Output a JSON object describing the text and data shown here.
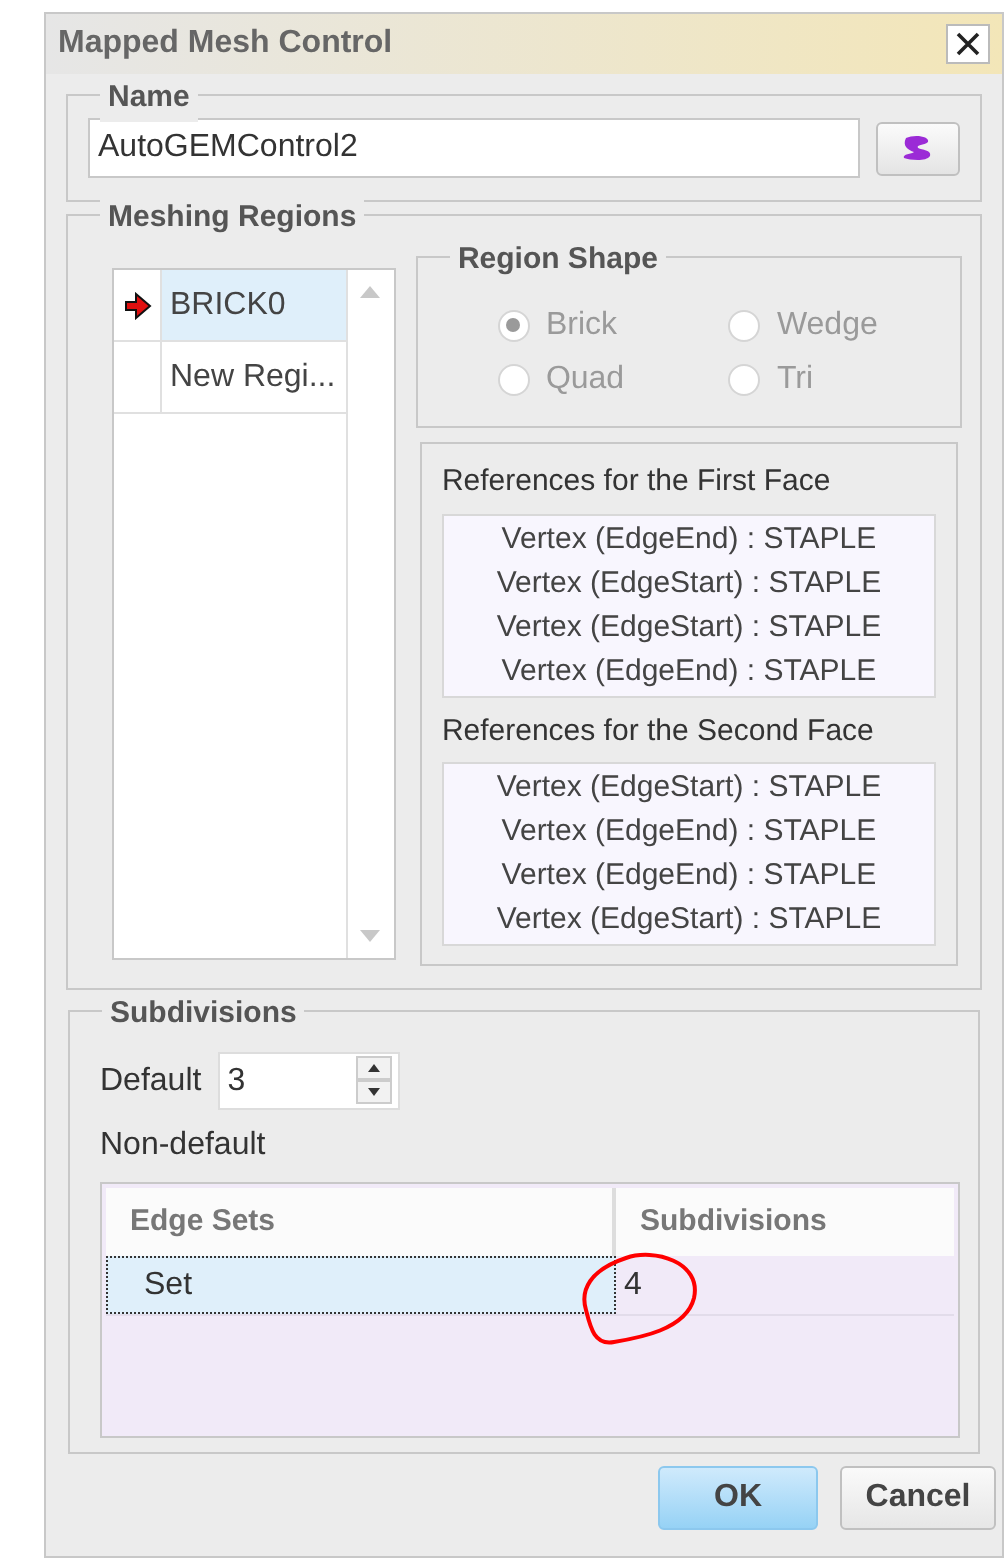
{
  "window": {
    "title": "Mapped Mesh Control"
  },
  "name_group": {
    "legend": "Name",
    "value": "AutoGEMControl2"
  },
  "meshing_regions": {
    "legend": "Meshing Regions",
    "items": [
      {
        "label": "BRICK0",
        "selected": true,
        "current": true
      },
      {
        "label": "New Regi...",
        "selected": false,
        "current": false
      }
    ],
    "region_shape": {
      "legend": "Region Shape",
      "disabled": true,
      "options": [
        {
          "label": "Brick",
          "selected": true
        },
        {
          "label": "Wedge",
          "selected": false
        },
        {
          "label": "Quad",
          "selected": false
        },
        {
          "label": "Tri",
          "selected": false
        }
      ]
    },
    "first_face": {
      "title": "References for the First Face",
      "items": [
        "Vertex (EdgeEnd) : STAPLE",
        "Vertex (EdgeStart) : STAPLE",
        "Vertex (EdgeStart) : STAPLE",
        "Vertex (EdgeEnd) : STAPLE"
      ]
    },
    "second_face": {
      "title": "References for the Second Face",
      "items": [
        "Vertex (EdgeStart) : STAPLE",
        "Vertex (EdgeEnd) : STAPLE",
        "Vertex (EdgeEnd) : STAPLE",
        "Vertex (EdgeStart) : STAPLE"
      ]
    }
  },
  "subdivisions": {
    "legend": "Subdivisions",
    "default_label": "Default",
    "default_value": "3",
    "non_default_label": "Non-default",
    "table": {
      "columns": [
        "Edge Sets",
        "Subdivisions"
      ],
      "rows": [
        {
          "cells": [
            "Set",
            "4"
          ],
          "selected": true
        }
      ]
    }
  },
  "buttons": [
    {
      "label": "OK",
      "primary": true
    },
    {
      "label": "Cancel",
      "primary": false
    }
  ]
}
